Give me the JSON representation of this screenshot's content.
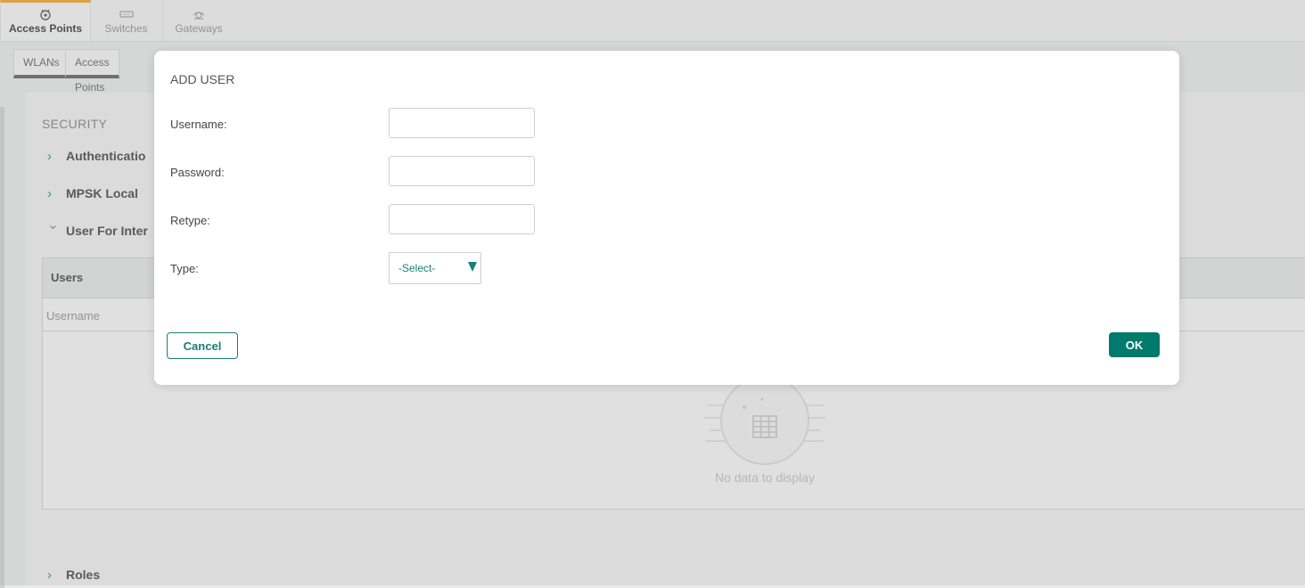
{
  "topnav": {
    "tabs": [
      {
        "label": "Access Points",
        "icon": "access-point-icon",
        "active": true
      },
      {
        "label": "Switches",
        "icon": "switch-icon",
        "active": false
      },
      {
        "label": "Gateways",
        "icon": "gateway-icon",
        "active": false
      }
    ]
  },
  "subnav": {
    "tabs": [
      {
        "label": "WLANs"
      },
      {
        "label": "Access Points"
      }
    ]
  },
  "security": {
    "title": "SECURITY",
    "sections": [
      {
        "label": "Authenticatio",
        "expanded": false
      },
      {
        "label": "MPSK Local",
        "expanded": false
      },
      {
        "label": "User For Inter",
        "expanded": true
      },
      {
        "label": "Roles",
        "expanded": false
      }
    ],
    "users_panel": {
      "title": "Users",
      "column_username": "Username",
      "empty_text": "No data to display"
    }
  },
  "modal": {
    "title": "ADD USER",
    "username_label": "Username:",
    "password_label": "Password:",
    "retype_label": "Retype:",
    "type_label": "Type:",
    "type_selected": "-Select-",
    "cancel_label": "Cancel",
    "ok_label": "OK"
  },
  "colors": {
    "accent": "#007a6c",
    "active_tab_border": "#f39c12"
  }
}
